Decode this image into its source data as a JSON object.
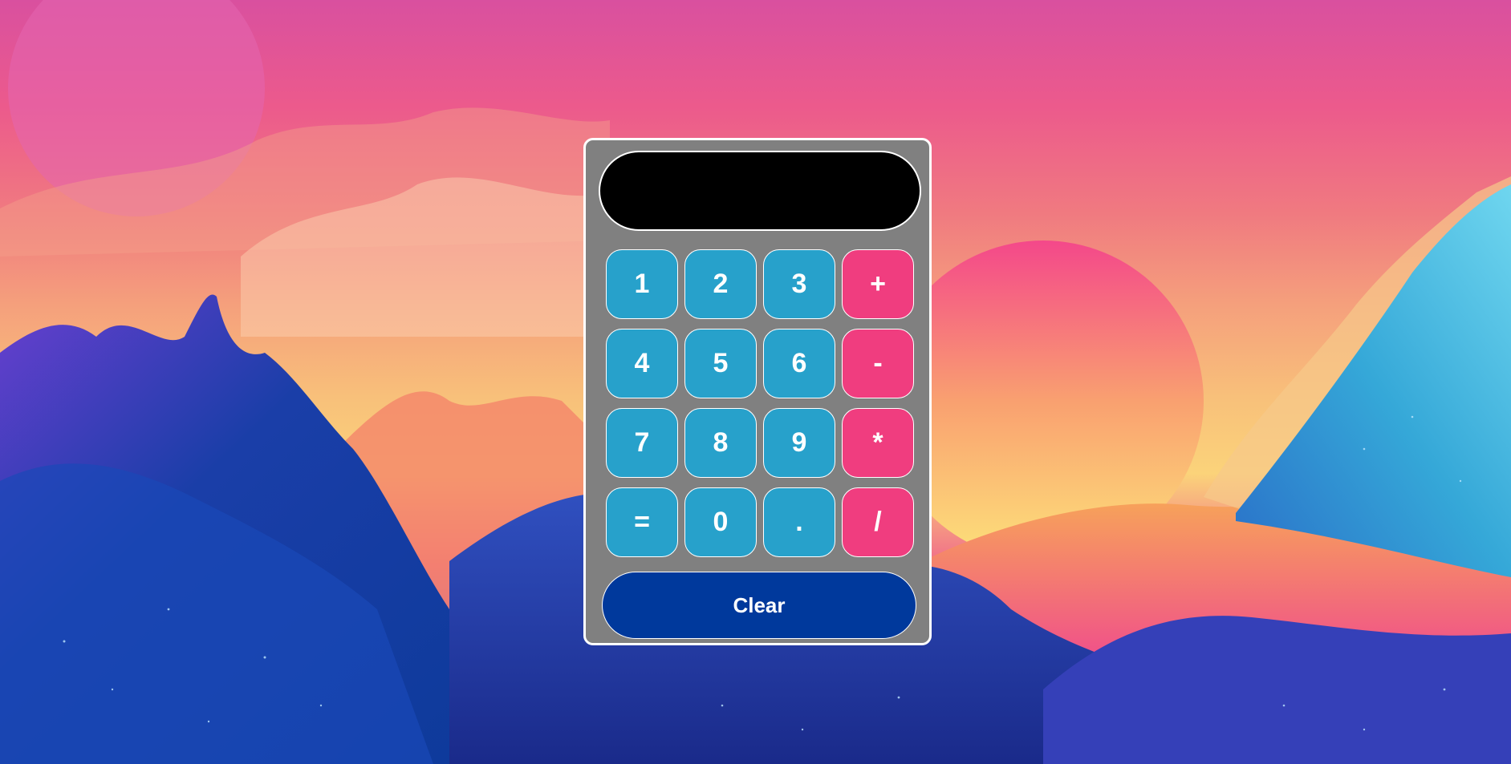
{
  "app": {
    "display_value": "",
    "keys": [
      "1",
      "2",
      "3",
      "+",
      "4",
      "5",
      "6",
      "-",
      "7",
      "8",
      "9",
      "*",
      "=",
      "0",
      ".",
      "/"
    ],
    "clear_label": "Clear"
  },
  "colors": {
    "calculator_body": "#808080",
    "display": "#000000",
    "digit_key": "#27a1cb",
    "operator_key": "#f03d7f",
    "clear_button": "#00399c",
    "border": "#ffffff"
  }
}
